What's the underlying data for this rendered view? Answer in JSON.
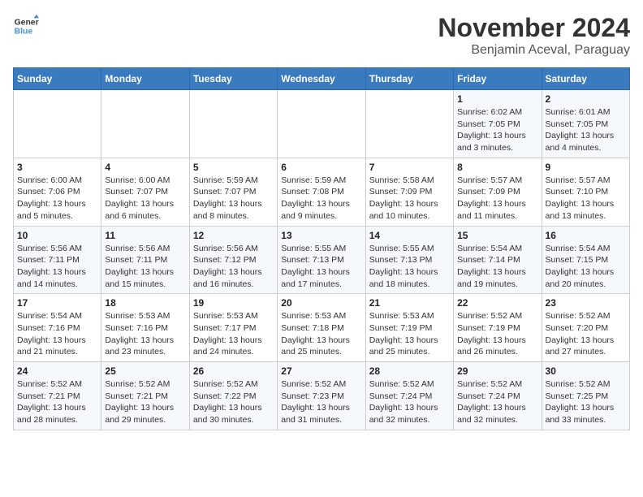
{
  "logo": {
    "line1": "General",
    "line2": "Blue"
  },
  "title": "November 2024",
  "location": "Benjamin Aceval, Paraguay",
  "weekdays": [
    "Sunday",
    "Monday",
    "Tuesday",
    "Wednesday",
    "Thursday",
    "Friday",
    "Saturday"
  ],
  "weeks": [
    [
      {
        "day": "",
        "sunrise": "",
        "sunset": "",
        "daylight": ""
      },
      {
        "day": "",
        "sunrise": "",
        "sunset": "",
        "daylight": ""
      },
      {
        "day": "",
        "sunrise": "",
        "sunset": "",
        "daylight": ""
      },
      {
        "day": "",
        "sunrise": "",
        "sunset": "",
        "daylight": ""
      },
      {
        "day": "",
        "sunrise": "",
        "sunset": "",
        "daylight": ""
      },
      {
        "day": "1",
        "sunrise": "Sunrise: 6:02 AM",
        "sunset": "Sunset: 7:05 PM",
        "daylight": "Daylight: 13 hours and 3 minutes."
      },
      {
        "day": "2",
        "sunrise": "Sunrise: 6:01 AM",
        "sunset": "Sunset: 7:05 PM",
        "daylight": "Daylight: 13 hours and 4 minutes."
      }
    ],
    [
      {
        "day": "3",
        "sunrise": "Sunrise: 6:00 AM",
        "sunset": "Sunset: 7:06 PM",
        "daylight": "Daylight: 13 hours and 5 minutes."
      },
      {
        "day": "4",
        "sunrise": "Sunrise: 6:00 AM",
        "sunset": "Sunset: 7:07 PM",
        "daylight": "Daylight: 13 hours and 6 minutes."
      },
      {
        "day": "5",
        "sunrise": "Sunrise: 5:59 AM",
        "sunset": "Sunset: 7:07 PM",
        "daylight": "Daylight: 13 hours and 8 minutes."
      },
      {
        "day": "6",
        "sunrise": "Sunrise: 5:59 AM",
        "sunset": "Sunset: 7:08 PM",
        "daylight": "Daylight: 13 hours and 9 minutes."
      },
      {
        "day": "7",
        "sunrise": "Sunrise: 5:58 AM",
        "sunset": "Sunset: 7:09 PM",
        "daylight": "Daylight: 13 hours and 10 minutes."
      },
      {
        "day": "8",
        "sunrise": "Sunrise: 5:57 AM",
        "sunset": "Sunset: 7:09 PM",
        "daylight": "Daylight: 13 hours and 11 minutes."
      },
      {
        "day": "9",
        "sunrise": "Sunrise: 5:57 AM",
        "sunset": "Sunset: 7:10 PM",
        "daylight": "Daylight: 13 hours and 13 minutes."
      }
    ],
    [
      {
        "day": "10",
        "sunrise": "Sunrise: 5:56 AM",
        "sunset": "Sunset: 7:11 PM",
        "daylight": "Daylight: 13 hours and 14 minutes."
      },
      {
        "day": "11",
        "sunrise": "Sunrise: 5:56 AM",
        "sunset": "Sunset: 7:11 PM",
        "daylight": "Daylight: 13 hours and 15 minutes."
      },
      {
        "day": "12",
        "sunrise": "Sunrise: 5:56 AM",
        "sunset": "Sunset: 7:12 PM",
        "daylight": "Daylight: 13 hours and 16 minutes."
      },
      {
        "day": "13",
        "sunrise": "Sunrise: 5:55 AM",
        "sunset": "Sunset: 7:13 PM",
        "daylight": "Daylight: 13 hours and 17 minutes."
      },
      {
        "day": "14",
        "sunrise": "Sunrise: 5:55 AM",
        "sunset": "Sunset: 7:13 PM",
        "daylight": "Daylight: 13 hours and 18 minutes."
      },
      {
        "day": "15",
        "sunrise": "Sunrise: 5:54 AM",
        "sunset": "Sunset: 7:14 PM",
        "daylight": "Daylight: 13 hours and 19 minutes."
      },
      {
        "day": "16",
        "sunrise": "Sunrise: 5:54 AM",
        "sunset": "Sunset: 7:15 PM",
        "daylight": "Daylight: 13 hours and 20 minutes."
      }
    ],
    [
      {
        "day": "17",
        "sunrise": "Sunrise: 5:54 AM",
        "sunset": "Sunset: 7:16 PM",
        "daylight": "Daylight: 13 hours and 21 minutes."
      },
      {
        "day": "18",
        "sunrise": "Sunrise: 5:53 AM",
        "sunset": "Sunset: 7:16 PM",
        "daylight": "Daylight: 13 hours and 23 minutes."
      },
      {
        "day": "19",
        "sunrise": "Sunrise: 5:53 AM",
        "sunset": "Sunset: 7:17 PM",
        "daylight": "Daylight: 13 hours and 24 minutes."
      },
      {
        "day": "20",
        "sunrise": "Sunrise: 5:53 AM",
        "sunset": "Sunset: 7:18 PM",
        "daylight": "Daylight: 13 hours and 25 minutes."
      },
      {
        "day": "21",
        "sunrise": "Sunrise: 5:53 AM",
        "sunset": "Sunset: 7:19 PM",
        "daylight": "Daylight: 13 hours and 25 minutes."
      },
      {
        "day": "22",
        "sunrise": "Sunrise: 5:52 AM",
        "sunset": "Sunset: 7:19 PM",
        "daylight": "Daylight: 13 hours and 26 minutes."
      },
      {
        "day": "23",
        "sunrise": "Sunrise: 5:52 AM",
        "sunset": "Sunset: 7:20 PM",
        "daylight": "Daylight: 13 hours and 27 minutes."
      }
    ],
    [
      {
        "day": "24",
        "sunrise": "Sunrise: 5:52 AM",
        "sunset": "Sunset: 7:21 PM",
        "daylight": "Daylight: 13 hours and 28 minutes."
      },
      {
        "day": "25",
        "sunrise": "Sunrise: 5:52 AM",
        "sunset": "Sunset: 7:21 PM",
        "daylight": "Daylight: 13 hours and 29 minutes."
      },
      {
        "day": "26",
        "sunrise": "Sunrise: 5:52 AM",
        "sunset": "Sunset: 7:22 PM",
        "daylight": "Daylight: 13 hours and 30 minutes."
      },
      {
        "day": "27",
        "sunrise": "Sunrise: 5:52 AM",
        "sunset": "Sunset: 7:23 PM",
        "daylight": "Daylight: 13 hours and 31 minutes."
      },
      {
        "day": "28",
        "sunrise": "Sunrise: 5:52 AM",
        "sunset": "Sunset: 7:24 PM",
        "daylight": "Daylight: 13 hours and 32 minutes."
      },
      {
        "day": "29",
        "sunrise": "Sunrise: 5:52 AM",
        "sunset": "Sunset: 7:24 PM",
        "daylight": "Daylight: 13 hours and 32 minutes."
      },
      {
        "day": "30",
        "sunrise": "Sunrise: 5:52 AM",
        "sunset": "Sunset: 7:25 PM",
        "daylight": "Daylight: 13 hours and 33 minutes."
      }
    ]
  ]
}
